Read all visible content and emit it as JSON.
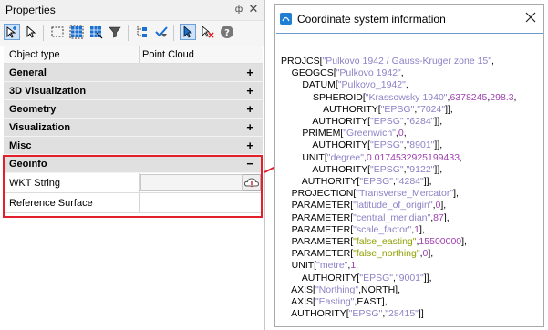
{
  "properties_panel": {
    "title": "Properties",
    "pin_glyph": "ф",
    "close_glyph": "✕",
    "header": {
      "col1": "Object type",
      "col2": "Point Cloud"
    },
    "categories": [
      {
        "label": "General",
        "toggle": "+"
      },
      {
        "label": "3D Visualization",
        "toggle": "+"
      },
      {
        "label": "Geometry",
        "toggle": "+"
      },
      {
        "label": "Visualization",
        "toggle": "+"
      },
      {
        "label": "Misc",
        "toggle": "+"
      },
      {
        "label": "Geoinfo",
        "toggle": "−"
      }
    ],
    "geoinfo_rows": [
      {
        "label": "WKT String",
        "value": ""
      },
      {
        "label": "Reference Surface",
        "value": ""
      }
    ],
    "toolbar_icons": [
      "add-point-icon",
      "select-arrow-icon",
      "select-rect-icon",
      "select-grid-icon",
      "select-grid-alt-icon",
      "filter-funnel-icon",
      "tree-icon",
      "check-filter-icon",
      "pointer-active-icon",
      "pointer-remove-icon",
      "help-icon"
    ],
    "highlight_color": "#e2202c"
  },
  "coord_window": {
    "title": "Coordinate system information",
    "icon": "coordinate-app-icon",
    "wkt_lines": [
      [
        "PROJCS[",
        "s:\"Pulkovo 1942 / Gauss-Kruger zone 15\"",
        ","
      ],
      [
        "    GEOGCS[",
        "s:\"Pulkovo 1942\"",
        ","
      ],
      [
        "        DATUM[",
        "s:\"Pulkovo_1942\"",
        ","
      ],
      [
        "            SPHEROID[",
        "s:\"Krassowsky 1940\"",
        ",",
        "n:6378245",
        ",",
        "n:298.3",
        ","
      ],
      [
        "                AUTHORITY[",
        "s:\"EPSG\"",
        ",",
        "s:\"7024\"",
        "]],"
      ],
      [
        "            AUTHORITY[",
        "s:\"EPSG\"",
        ",",
        "s:\"6284\"",
        "]],"
      ],
      [
        "        PRIMEM[",
        "s:\"Greenwich\"",
        ",",
        "n:0",
        ","
      ],
      [
        "            AUTHORITY[",
        "s:\"EPSG\"",
        ",",
        "s:\"8901\"",
        "]],"
      ],
      [
        "        UNIT[",
        "s:\"degree\"",
        ",",
        "n:0.0174532925199433",
        ","
      ],
      [
        "            AUTHORITY[",
        "s:\"EPSG\"",
        ",",
        "s:\"9122\"",
        "]],"
      ],
      [
        "        AUTHORITY[",
        "s:\"EPSG\"",
        ",",
        "s:\"4284\"",
        "]],"
      ],
      [
        "    PROJECTION[",
        "s:\"Transverse_Mercator\"",
        "],"
      ],
      [
        "    PARAMETER[",
        "s:\"latitude_of_origin\"",
        ",",
        "n:0",
        "],"
      ],
      [
        "    PARAMETER[",
        "s:\"central_meridian\"",
        ",",
        "n:87",
        "],"
      ],
      [
        "    PARAMETER[",
        "s:\"scale_factor\"",
        ",",
        "n:1",
        "],"
      ],
      [
        "    PARAMETER[",
        "g:\"false_easting\"",
        ",",
        "n:15500000",
        "],"
      ],
      [
        "    PARAMETER[",
        "g:\"false_northing\"",
        ",",
        "n:0",
        "],"
      ],
      [
        "    UNIT[",
        "s:\"metre\"",
        ",",
        "n:1",
        ","
      ],
      [
        "        AUTHORITY[",
        "s:\"EPSG\"",
        ",",
        "s:\"9001\"",
        "]],"
      ],
      [
        "    AXIS[",
        "s:\"Northing\"",
        ",NORTH],"
      ],
      [
        "    AXIS[",
        "s:\"Easting\"",
        ",EAST],"
      ],
      [
        "    AUTHORITY[",
        "s:\"EPSG\"",
        ",",
        "s:\"28415\"",
        "]]"
      ]
    ],
    "colors": {
      "string": "#8c82c6",
      "number": "#a040b0",
      "highlight": "#90a000"
    }
  }
}
